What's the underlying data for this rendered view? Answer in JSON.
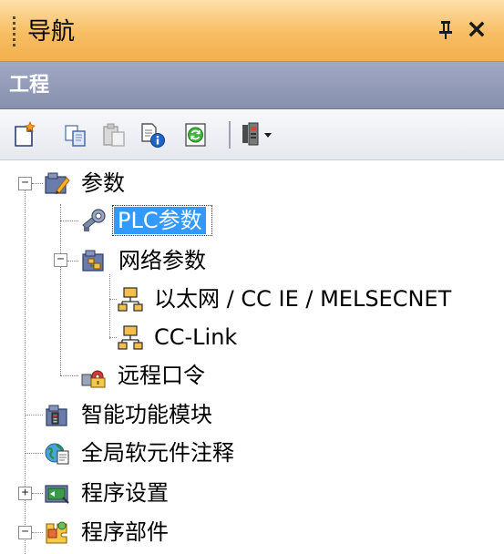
{
  "panel": {
    "title": "导航",
    "pin_glyph": "ᵖ",
    "close_glyph": "×"
  },
  "section": {
    "label": "工程"
  },
  "toolbar": {
    "buttons": [
      {
        "icon": "new-data-icon"
      },
      {
        "icon": "copy-icon"
      },
      {
        "icon": "paste-icon"
      },
      {
        "icon": "properties-icon"
      },
      {
        "icon": "refresh-icon"
      },
      {
        "icon": "display-options-icon"
      }
    ]
  },
  "tree": {
    "nodes": [
      {
        "label": "参数",
        "icon": "parameter-icon",
        "expander": "−"
      },
      {
        "label": "PLC参数",
        "icon": "plc-parameter-icon",
        "selected": true
      },
      {
        "label": "网络参数",
        "icon": "network-parameter-icon",
        "expander": "−"
      },
      {
        "label": "以太网 / CC IE / MELSECNET",
        "icon": "network-node-icon"
      },
      {
        "label": "CC-Link",
        "icon": "network-node-icon"
      },
      {
        "label": "远程口令",
        "icon": "remote-password-icon"
      },
      {
        "label": "智能功能模块",
        "icon": "intelligent-module-icon"
      },
      {
        "label": "全局软元件注释",
        "icon": "global-comment-icon"
      },
      {
        "label": "程序设置",
        "icon": "program-setting-icon",
        "expander": "+"
      },
      {
        "label": "程序部件",
        "icon": "program-parts-icon",
        "expander": "−"
      }
    ]
  }
}
